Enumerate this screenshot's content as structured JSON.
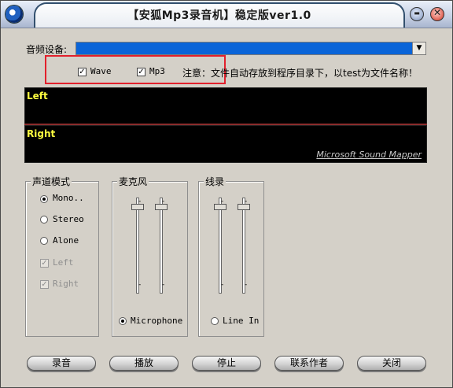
{
  "window": {
    "title": "【安狐Mp3录音机】稳定版ver1.0",
    "min_label": "▬",
    "close_label": "✕"
  },
  "device": {
    "label": "音频设备:",
    "value": ""
  },
  "formats": {
    "wave_label": "Wave",
    "wave_checked": true,
    "mp3_label": "Mp3",
    "mp3_checked": true
  },
  "note": "注意：文件自动存放到程序目录下，以test为文件名称！",
  "meters": {
    "left_label": "Left",
    "right_label": "Right",
    "mapper_link": "Microsoft Sound Mapper"
  },
  "channel_mode": {
    "title": "声道模式",
    "options": [
      "Mono..",
      "Stereo",
      "Alone"
    ],
    "selected": "Mono..",
    "left_label": "Left",
    "right_label": "Right"
  },
  "mic": {
    "title": "麦克风",
    "radio_label": "Microphone",
    "selected": true,
    "level": 0.1
  },
  "line": {
    "title": "线录",
    "radio_label": "Line In",
    "selected": false,
    "level": 0.1
  },
  "buttons": {
    "record": "录音",
    "play": "播放",
    "stop": "停止",
    "contact": "联系作者",
    "close": "关闭"
  },
  "accent_colors": {
    "selection_blue": "#0a64d8",
    "meter_label": "#ffff40",
    "highlight_red": "#e2202c"
  }
}
